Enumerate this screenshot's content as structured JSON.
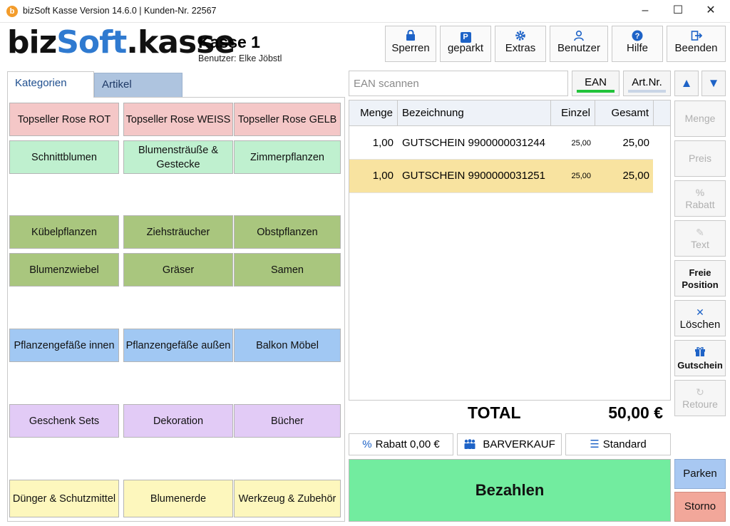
{
  "window": {
    "title": "bizSoft Kasse Version 14.6.0 | Kunden-Nr. 22567",
    "app_icon_letter": "b",
    "minimize": "–",
    "maximize": "☐",
    "close": "✕"
  },
  "header": {
    "logo": {
      "biz": "biz",
      "soft": "Soft",
      "kasse": ".kasse"
    },
    "register_title": "Kasse 1",
    "user_line": "Benutzer: Elke Jöbstl",
    "buttons": [
      {
        "label": "Sperren",
        "icon": "lock-icon"
      },
      {
        "label": "geparkt",
        "icon": "parking-icon"
      },
      {
        "label": "Extras",
        "icon": "gear-icon"
      },
      {
        "label": "Benutzer",
        "icon": "user-icon"
      },
      {
        "label": "Hilfe",
        "icon": "help-icon"
      },
      {
        "label": "Beenden",
        "icon": "exit-icon"
      }
    ]
  },
  "tabs": {
    "kategorien": "Kategorien",
    "artikel": "Artikel"
  },
  "categories": [
    {
      "label": "Topseller Rose ROT",
      "color": "#f4c7c7"
    },
    {
      "label": "Topseller Rose WEISS",
      "color": "#f4c7c7"
    },
    {
      "label": "Topseller Rose GELB",
      "color": "#f4c7c7"
    },
    {
      "label": "Schnittblumen",
      "color": "#bff0cf"
    },
    {
      "label": "Blumensträuße & Gestecke",
      "color": "#bff0cf"
    },
    {
      "label": "Zimmerpflanzen",
      "color": "#bff0cf"
    },
    {
      "label": "Kübelpflanzen",
      "color": "#a9c67e"
    },
    {
      "label": "Ziehsträucher",
      "color": "#a9c67e"
    },
    {
      "label": "Obstpflanzen",
      "color": "#a9c67e"
    },
    {
      "label": "Blumenzwiebel",
      "color": "#a9c67e"
    },
    {
      "label": "Gräser",
      "color": "#a9c67e"
    },
    {
      "label": "Samen",
      "color": "#a9c67e"
    },
    {
      "label": "Pflanzengefäße innen",
      "color": "#a1c8f3"
    },
    {
      "label": "Pflanzengefäße außen",
      "color": "#a1c8f3"
    },
    {
      "label": "Balkon Möbel",
      "color": "#a1c8f3"
    },
    {
      "label": "Geschenk Sets",
      "color": "#e2cbf6"
    },
    {
      "label": "Dekoration",
      "color": "#e2cbf6"
    },
    {
      "label": "Bücher",
      "color": "#e2cbf6"
    },
    {
      "label": "Dünger & Schutzmittel",
      "color": "#fdf7bd"
    },
    {
      "label": "Blumenerde",
      "color": "#fdf7bd"
    },
    {
      "label": "Werkzeug & Zubehör",
      "color": "#fdf7bd"
    }
  ],
  "scan": {
    "placeholder": "EAN scannen",
    "ean_label": "EAN",
    "artnr_label": "Art.Nr.",
    "up": "▲",
    "down": "▼"
  },
  "table": {
    "headers": {
      "menge": "Menge",
      "bezeichnung": "Bezeichnung",
      "einzel": "Einzel",
      "gesamt": "Gesamt"
    },
    "rows": [
      {
        "menge": "1,00",
        "bezeichnung": "GUTSCHEIN 9900000031244",
        "einzel": "25,00",
        "gesamt": "25,00"
      },
      {
        "menge": "1,00",
        "bezeichnung": "GUTSCHEIN 9900000031251",
        "einzel": "25,00",
        "gesamt": "25,00"
      }
    ]
  },
  "total": {
    "label": "TOTAL",
    "value": "50,00 €"
  },
  "options": {
    "rabatt": "Rabatt 0,00 €",
    "verkauf": "BARVERKAUF",
    "preisliste": "Standard"
  },
  "pay_label": "Bezahlen",
  "side": {
    "menge": "Menge",
    "preis": "Preis",
    "rabatt": "Rabatt",
    "text": "Text",
    "freie_1": "Freie",
    "freie_2": "Position",
    "loeschen": "Löschen",
    "gutschein": "Gutschein",
    "retoure": "Retoure",
    "parken": "Parken",
    "storno": "Storno"
  },
  "colors": {
    "accent": "#1e63c7",
    "pay": "#72ec9f",
    "selected_row": "#f8e3a0",
    "ean_indicator": "#22c33b",
    "artnr_indicator": "#c9d5e6",
    "parken": "#a8c8f2",
    "storno": "#f2a79a"
  }
}
